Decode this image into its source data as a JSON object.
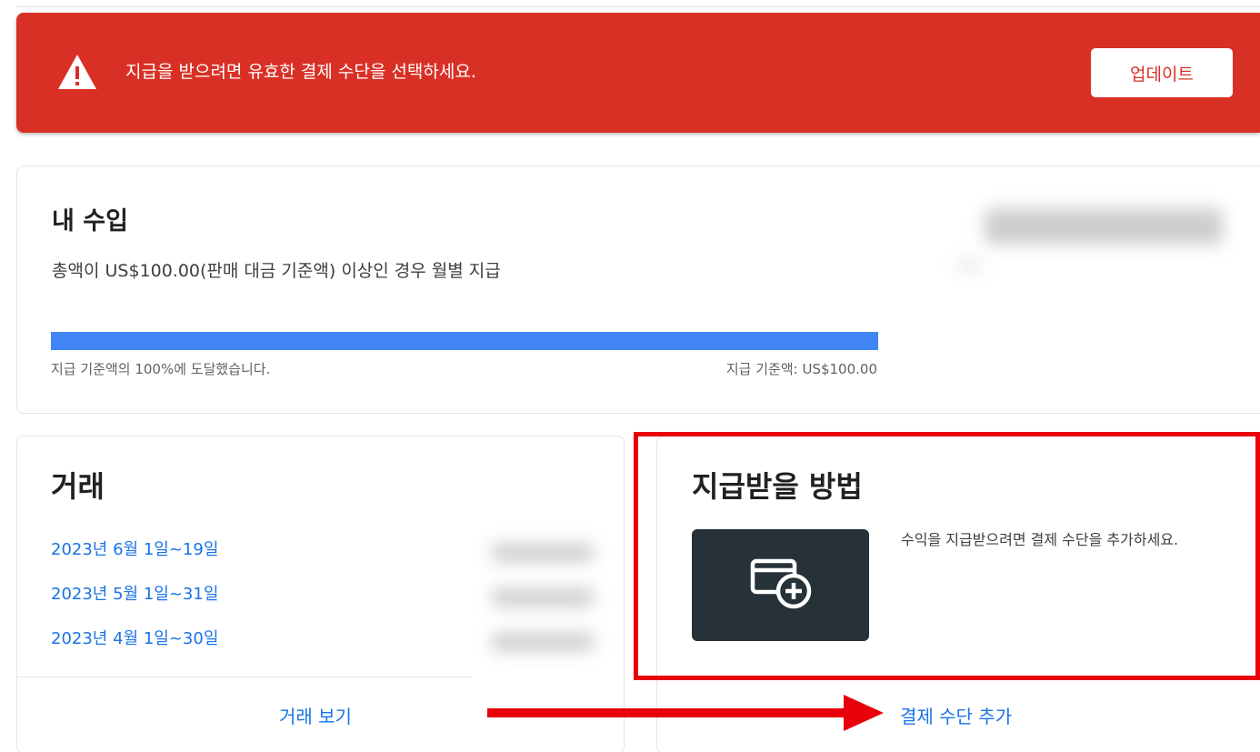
{
  "alert": {
    "message": "지급을 받으려면 유효한 결제 수단을 선택하세요.",
    "button_label": "업데이트",
    "icon": "warning-icon"
  },
  "earnings": {
    "title": "내 수입",
    "description": "총액이 US$100.00(판매 대금 기준액) 이상인 경우 월별 지급",
    "progress_percent": 100,
    "progress_left_label": "지급 기준액의 100%에 도달했습니다.",
    "progress_right_label": "지급 기준액: US$100.00"
  },
  "transactions": {
    "title": "거래",
    "items": [
      {
        "label": "2023년 6월 1일~19일"
      },
      {
        "label": "2023년 5월 1일~31일"
      },
      {
        "label": "2023년 4월 1일~30일"
      }
    ],
    "view_label": "거래 보기"
  },
  "payment": {
    "title": "지급받을 방법",
    "description": "수익을 지급받으려면 결제 수단을 추가하세요.",
    "icon": "add-card-icon",
    "add_label": "결제 수단 추가"
  },
  "colors": {
    "alert_red": "#d93025",
    "link_blue": "#1a73e8",
    "progress_blue": "#4285f4",
    "tile_dark": "#263238",
    "annotation_red": "#e8000b"
  }
}
